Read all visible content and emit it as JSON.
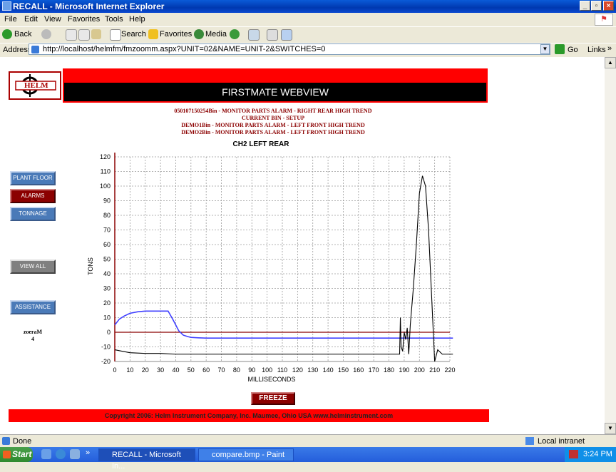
{
  "window": {
    "title": "RECALL - Microsoft Internet Explorer"
  },
  "menu": [
    "File",
    "Edit",
    "View",
    "Favorites",
    "Tools",
    "Help"
  ],
  "toolbar": {
    "back": "Back",
    "search": "Search",
    "favorites": "Favorites",
    "media": "Media"
  },
  "address": {
    "label": "Address",
    "url": "http://localhost/helmfm/fmzoomm.aspx?UNIT=02&NAME=UNIT-2&SWITCHES=0",
    "go": "Go",
    "links": "Links"
  },
  "page": {
    "logo_text": "HELM",
    "title": "FIRSTMATE WEBVIEW",
    "alarms": [
      "050107150254Bin - MONITOR PARTS ALARM - RIGHT REAR HIGH TREND",
      "CURRENT BIN - SETUP",
      "DEMO1Bin - MONITOR PARTS ALARM - LEFT FRONT HIGH TREND",
      "DEMO2Bin - MONITOR PARTS ALARM - LEFT FRONT HIGH TREND"
    ],
    "nav": {
      "plant_floor": "PLANT FLOOR",
      "alarms": "ALARMS",
      "tonnage": "TONNAGE",
      "view_all": "VIEW ALL",
      "assistance": "ASSISTANCE"
    },
    "side_label_1": "zoeraM",
    "side_label_2": "4",
    "freeze": "FREEZE",
    "footer": "Copyright 2006: Helm Instrument Company, Inc.   Maumee, Ohio USA   www.helminstrument.com"
  },
  "status": {
    "left": "Done",
    "zone": "Local intranet"
  },
  "taskbar": {
    "start": "Start",
    "tasks": [
      "RECALL - Microsoft In...",
      "compare.bmp - Paint"
    ],
    "clock": "3:24 PM"
  },
  "chart_data": {
    "type": "line",
    "title": "CH2 LEFT REAR",
    "xlabel": "MILLISECONDS",
    "ylabel": "TONS",
    "xlim": [
      0,
      220
    ],
    "ylim": [
      -20,
      120
    ],
    "x_ticks": [
      0,
      10,
      20,
      30,
      40,
      50,
      60,
      70,
      80,
      90,
      100,
      110,
      120,
      130,
      140,
      150,
      160,
      170,
      180,
      190,
      200,
      210,
      220
    ],
    "y_ticks": [
      -20,
      -10,
      0,
      10,
      20,
      30,
      40,
      50,
      60,
      70,
      80,
      90,
      100,
      110,
      120
    ],
    "grid": true,
    "zero_line_color": "#8b0000",
    "series": [
      {
        "color": "#4040ff",
        "x": [
          0,
          3,
          6,
          10,
          15,
          20,
          25,
          30,
          35,
          38,
          40,
          42,
          45,
          48,
          50,
          55,
          60,
          80,
          100,
          120,
          140,
          160,
          180,
          190,
          200,
          210,
          222
        ],
        "y": [
          5,
          9,
          11,
          13,
          14,
          14.5,
          14.5,
          14.5,
          14.5,
          9,
          5,
          1,
          -2,
          -3,
          -3.5,
          -3.8,
          -4,
          -4,
          -4,
          -4,
          -4,
          -4,
          -4,
          -4,
          -4,
          -4,
          -4
        ]
      },
      {
        "color": "#000000",
        "x": [
          0,
          5,
          10,
          20,
          30,
          40,
          50,
          60,
          80,
          100,
          120,
          140,
          160,
          180,
          187,
          187.5,
          188,
          189,
          190,
          191,
          192,
          193,
          194,
          196,
          198,
          200,
          202,
          204,
          206,
          208,
          210,
          212,
          215,
          222
        ],
        "y": [
          -12,
          -13,
          -14,
          -14.5,
          -14.5,
          -15,
          -15,
          -15,
          -15,
          -15,
          -15,
          -15,
          -15,
          -15,
          -15,
          10,
          -10,
          -13,
          0,
          -5,
          3,
          -15,
          5,
          30,
          60,
          95,
          107,
          100,
          70,
          25,
          -20,
          -12,
          -15,
          -15
        ]
      }
    ]
  }
}
